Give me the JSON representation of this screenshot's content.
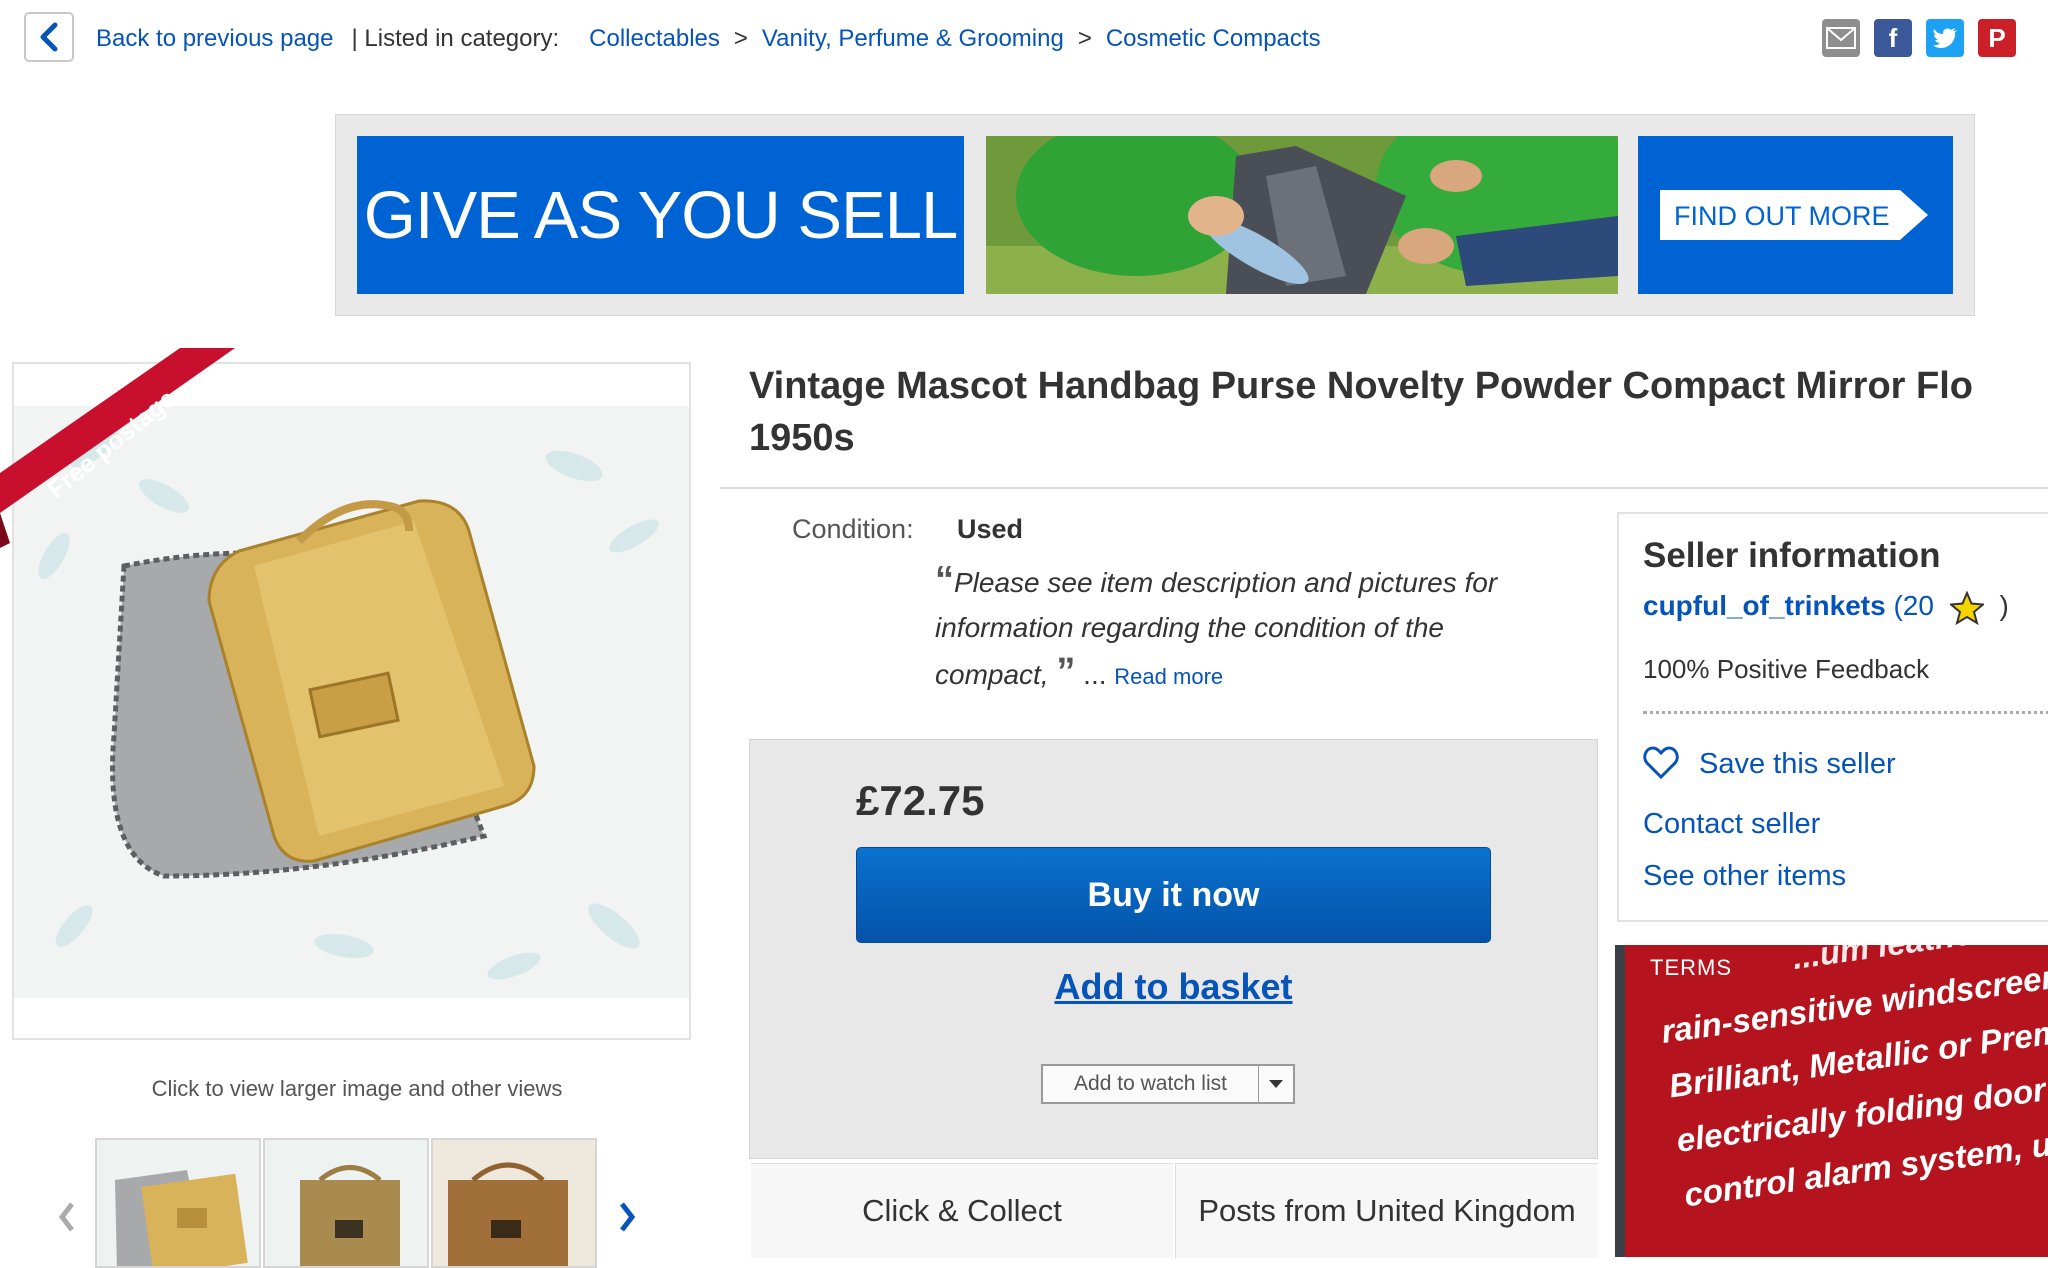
{
  "nav": {
    "back_label": "Back to previous page",
    "listed_prefix": "| Listed in category:",
    "breadcrumb": [
      "Collectables",
      "Vanity, Perfume & Grooming",
      "Cosmetic Compacts"
    ],
    "breadcrumb_sep": ">"
  },
  "share": {
    "icons": [
      "email-icon",
      "facebook-icon",
      "twitter-icon",
      "pinterest-icon"
    ],
    "facebook_glyph": "f",
    "pinterest_glyph": "P"
  },
  "banner": {
    "headline": "GIVE AS YOU SELL",
    "cta": "FIND OUT MORE",
    "color": "#0063d4"
  },
  "gallery": {
    "ribbon": "Free postage",
    "caption": "Click to view larger image and other views"
  },
  "item": {
    "title_line1": "Vintage Mascot Handbag Purse Novelty Powder Compact Mirror Flo",
    "title_line2": "1950s",
    "condition_label": "Condition:",
    "condition_value": "Used",
    "quote_text": "Please see item description and pictures for information regarding the condition of the compact,",
    "quote_more": " ... ",
    "read_more": "Read more"
  },
  "buy": {
    "price": "£72.75",
    "buy_now": "Buy it now",
    "add_basket": "Add to basket",
    "watch": "Add to watch list",
    "collect": "Click & Collect",
    "posts_from": "Posts from United Kingdom"
  },
  "seller": {
    "heading": "Seller information",
    "name": "cupful_of_trinkets",
    "score": "(20",
    "close_paren": ")",
    "feedback": "100% Positive Feedback",
    "save": "Save this seller",
    "contact": "Contact seller",
    "other": "See other items"
  },
  "ad": {
    "terms": "TERMS",
    "lines": [
      "...um leather-effe...",
      "rain-sensitive windscreen wip",
      "Brilliant, Metallic or Premium",
      "electrically folding door mirr",
      "control alarm system, unique"
    ],
    "color": "#b5141f"
  },
  "colors": {
    "link": "#0654ba",
    "button": "#0a72cf"
  }
}
